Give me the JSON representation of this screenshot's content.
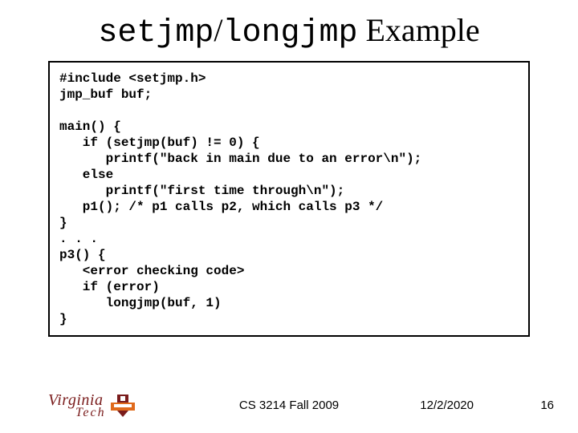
{
  "title": {
    "part1_mono": "setjmp",
    "slash": "/",
    "part2_mono": "longjmp",
    "rest": " Example"
  },
  "code": "#include <setjmp.h>\njmp_buf buf;\n\nmain() {\n   if (setjmp(buf) != 0) {\n      printf(\"back in main due to an error\\n\");\n   else\n      printf(\"first time through\\n\");\n   p1(); /* p1 calls p2, which calls p3 */\n}\n. . .\np3() {\n   <error checking code>\n   if (error)\n      longjmp(buf, 1)\n}",
  "footer": {
    "logo_line1": "Virginia",
    "logo_line2": "Tech",
    "course": "CS 3214 Fall 2009",
    "date": "12/2/2020",
    "page": "16"
  }
}
